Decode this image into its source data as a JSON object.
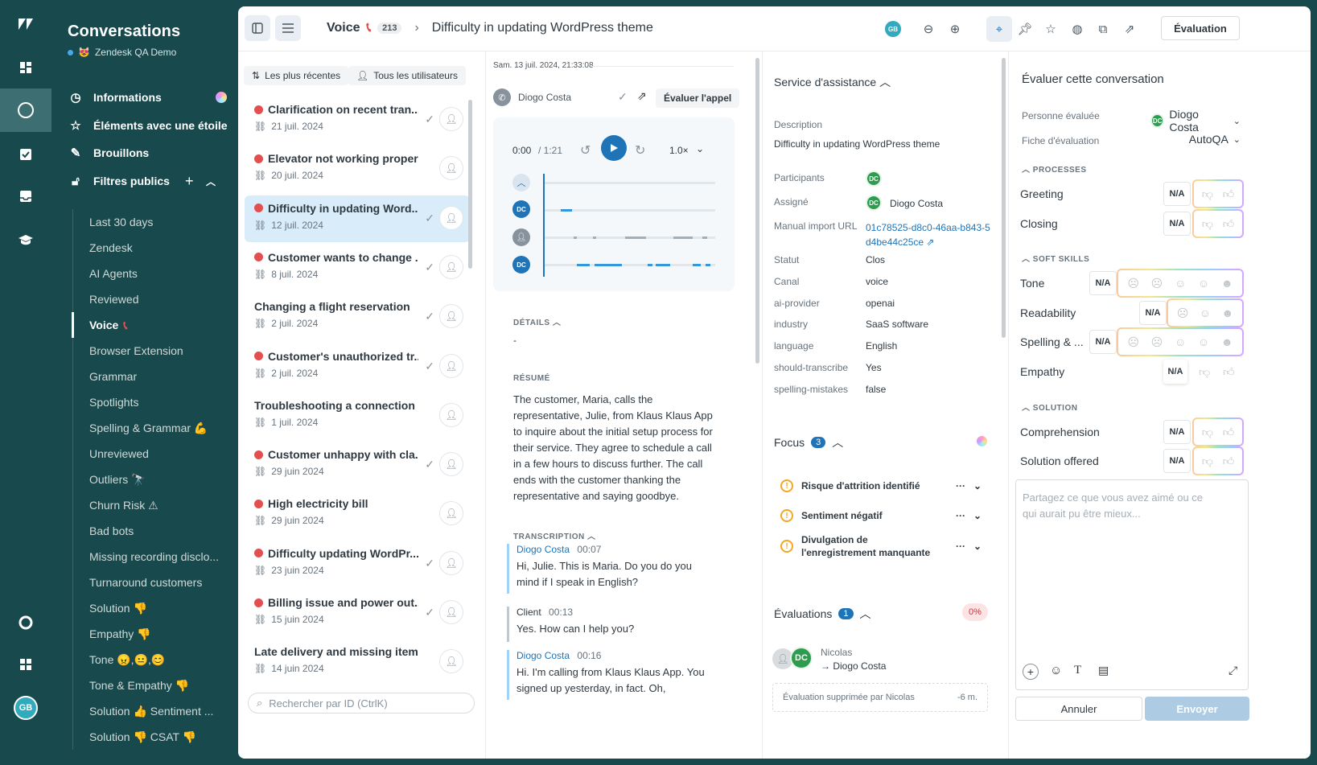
{
  "rail": {
    "items": [
      "zendesk-logo",
      "dashboard-icon",
      "conversations-icon",
      "tasks-icon",
      "inbox-icon",
      "training-icon",
      "help-icon",
      "apps-icon"
    ],
    "user_initials": "GB"
  },
  "sidebar": {
    "title": "Conversations",
    "workspace": "Zendesk QA Demo",
    "nav": [
      {
        "label": "Informations"
      },
      {
        "label": "Éléments avec une étoile"
      },
      {
        "label": "Brouillons"
      },
      {
        "label": "Filtres publics"
      }
    ],
    "filters": [
      "Last 30 days",
      "Zendesk",
      "AI Agents",
      "Reviewed",
      "Voice",
      "Browser Extension",
      "Grammar",
      "Spotlights",
      "Spelling & Grammar 💪",
      "Unreviewed",
      "Outliers 🔭",
      "Churn Risk ⚠",
      "Bad bots",
      "Missing recording disclo...",
      "Turnaround customers",
      "Solution 👎",
      "Empathy 👎",
      "Tone 😠,😐,😊",
      "Tone & Empathy 👎",
      "Solution 👍 Sentiment ...",
      "Solution 👎 CSAT 👎"
    ]
  },
  "header": {
    "channel": "Voice",
    "count": "213",
    "title": "Difficulty in updating WordPress theme",
    "user_initials": "GB",
    "evaluate_button": "Évaluation"
  },
  "list": {
    "chip_recent": "Les plus récentes",
    "chip_users": "Tous les utilisateurs",
    "search_placeholder": "Rechercher par ID (CtrlK)",
    "items": [
      {
        "title": "Clarification on recent tran...",
        "date": "21 juil. 2024",
        "sad": true,
        "check": true
      },
      {
        "title": "Elevator not working properly",
        "date": "20 juil. 2024",
        "sad": true,
        "check": false
      },
      {
        "title": "Difficulty in updating Word...",
        "date": "12 juil. 2024",
        "sad": true,
        "check": true
      },
      {
        "title": "Customer wants to change ...",
        "date": "8 juil. 2024",
        "sad": true,
        "check": true
      },
      {
        "title": "Changing a flight reservation",
        "date": "2 juil. 2024",
        "sad": false,
        "check": true
      },
      {
        "title": "Customer's unauthorized tr...",
        "date": "2 juil. 2024",
        "sad": true,
        "check": true
      },
      {
        "title": "Troubleshooting a connection iss...",
        "date": "1 juil. 2024",
        "sad": false,
        "check": false
      },
      {
        "title": "Customer unhappy with cla...",
        "date": "29 juin 2024",
        "sad": true,
        "check": true
      },
      {
        "title": "High electricity bill",
        "date": "29 juin 2024",
        "sad": true,
        "check": false
      },
      {
        "title": "Difficulty updating WordPr...",
        "date": "23 juin 2024",
        "sad": true,
        "check": true
      },
      {
        "title": "Billing issue and power out...",
        "date": "15 juin 2024",
        "sad": true,
        "check": true
      },
      {
        "title": "Late delivery and missing item",
        "date": "14 juin 2024",
        "sad": false,
        "check": false
      }
    ]
  },
  "call": {
    "timestamp": "Sam. 13 juil. 2024, 21:33:08",
    "agent": "Diogo Costa",
    "rate_call": "Évaluer l'appel",
    "time_current": "0:00",
    "time_total": "1:21",
    "speed": "1.0×",
    "speaker1": "DC",
    "speaker3": "DC",
    "details_label": "DÉTAILS",
    "details_value": "-",
    "summary_label": "RÉSUMÉ",
    "summary": "The customer, Maria, calls the representative, Julie, from Klaus Klaus App to inquire about the initial setup process for their service. They agree to schedule a call in a few hours to discuss further. The call ends with the customer thanking the representative and saying goodbye.",
    "transcript_label": "TRANSCRIPTION",
    "transcript": [
      {
        "speaker": "Diogo Costa",
        "time": "00:07",
        "text": "Hi, Julie. This is Maria. Do you do you mind if I speak in English?"
      },
      {
        "speaker": "Client",
        "time": "00:13",
        "text": "Yes. How can I help you?"
      },
      {
        "speaker": "Diogo Costa",
        "time": "00:16",
        "text": "Hi. I'm calling from Klaus Klaus App. You signed up yesterday, in fact. Oh,"
      }
    ]
  },
  "ticket": {
    "section": "Service d'assistance",
    "desc_label": "Description",
    "desc": "Difficulty in updating WordPress theme",
    "participants_label": "Participants",
    "participants_initials": "DC",
    "assignee_label": "Assigné",
    "assignee_initials": "DC",
    "assignee": "Diogo Costa",
    "url_label": "Manual import URL",
    "url_line1": "01c78525-d8c0-46aa-b843-5",
    "url_line2": "d4be44c25ce",
    "fields": [
      {
        "k": "Statut",
        "v": "Clos"
      },
      {
        "k": "Canal",
        "v": "voice"
      },
      {
        "k": "ai-provider",
        "v": "openai"
      },
      {
        "k": "industry",
        "v": "SaaS software"
      },
      {
        "k": "language",
        "v": "English"
      },
      {
        "k": "should-transcribe",
        "v": "Yes"
      },
      {
        "k": "spelling-mistakes",
        "v": "false"
      }
    ],
    "focus_label": "Focus",
    "focus_count": "3",
    "focus": [
      "Risque d'attrition identifié",
      "Sentiment négatif",
      "Divulgation de l'enregistrement manquante"
    ],
    "evals_label": "Évaluations",
    "evals_count": "1",
    "evals_score": "0%",
    "reviewer": "Nicolas",
    "reviewee": "→ Diogo Costa",
    "reviewee_initials": "DC",
    "deleted": "Évaluation supprimée par Nicolas",
    "deleted_time": "-6 m."
  },
  "review": {
    "title": "Évaluer cette conversation",
    "person_label": "Personne évaluée",
    "person": "Diogo Costa",
    "person_initials": "DC",
    "sheet_label": "Fiche d'évaluation",
    "sheet": "AutoQA",
    "sections": [
      {
        "name": "PROCESSES",
        "items": [
          "Greeting",
          "Closing"
        ]
      },
      {
        "name": "SOFT SKILLS",
        "items": [
          "Tone",
          "Readability",
          "Spelling & ...",
          "Empathy"
        ]
      },
      {
        "name": "SOLUTION",
        "items": [
          "Comprehension",
          "Solution offered"
        ]
      }
    ],
    "na": "N/A",
    "comment_placeholder": "Partagez ce que vous avez aimé ou ce qui aurait pu être mieux...",
    "cancel": "Annuler",
    "submit": "Envoyer"
  }
}
